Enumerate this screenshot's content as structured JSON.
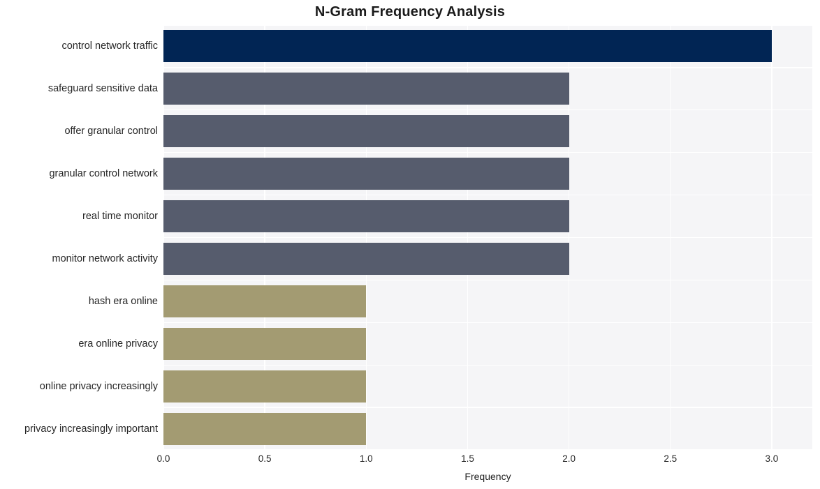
{
  "chart_data": {
    "type": "bar",
    "orientation": "horizontal",
    "title": "N-Gram Frequency Analysis",
    "xlabel": "Frequency",
    "ylabel": "",
    "xlim": [
      0,
      3.2
    ],
    "xticks": [
      "0.0",
      "0.5",
      "1.0",
      "1.5",
      "2.0",
      "2.5",
      "3.0"
    ],
    "xtick_values": [
      0,
      0.5,
      1,
      1.5,
      2,
      2.5,
      3
    ],
    "grid": true,
    "legend": "none",
    "categories": [
      "control network traffic",
      "safeguard sensitive data",
      "offer granular control",
      "granular control network",
      "real time monitor",
      "monitor network activity",
      "hash era online",
      "era online privacy",
      "online privacy increasingly",
      "privacy increasingly important"
    ],
    "values": [
      3,
      2,
      2,
      2,
      2,
      2,
      1,
      1,
      1,
      1
    ],
    "bar_colors": [
      "#012554",
      "#565c6d",
      "#565c6d",
      "#565c6d",
      "#565c6d",
      "#565c6d",
      "#a39b72",
      "#a39b72",
      "#a39b72",
      "#a39b72"
    ],
    "plot_background": "#f5f5f7",
    "gridline_color": "#ffffff",
    "figure_background": "#ffffff"
  }
}
